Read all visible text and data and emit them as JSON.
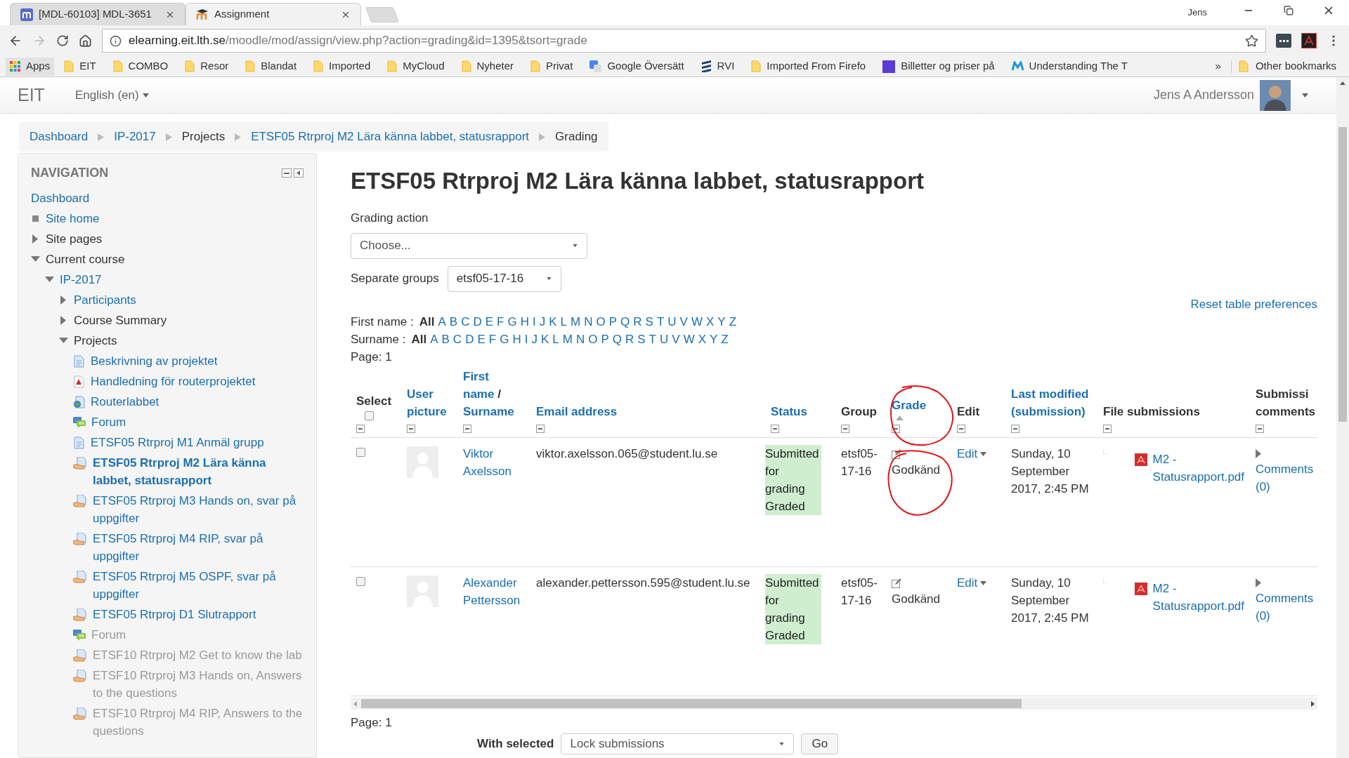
{
  "browser": {
    "tabs": [
      {
        "title": "[MDL-60103] MDL-3651",
        "selected": false
      },
      {
        "title": "Assignment",
        "selected": true
      }
    ],
    "profile": "Jens",
    "address": {
      "domain": "elearning.eit.lth.se",
      "path": "/moodle/mod/assign/view.php?action=grading&id=1395&tsort=grade"
    },
    "bookmarks": [
      {
        "label": "Apps",
        "kind": "apps"
      },
      {
        "label": "EIT",
        "kind": "folder"
      },
      {
        "label": "COMBO",
        "kind": "folder"
      },
      {
        "label": "Resor",
        "kind": "folder"
      },
      {
        "label": "Blandat",
        "kind": "folder"
      },
      {
        "label": "Imported",
        "kind": "folder"
      },
      {
        "label": "MyCloud",
        "kind": "folder"
      },
      {
        "label": "Nyheter",
        "kind": "folder"
      },
      {
        "label": "Privat",
        "kind": "folder"
      },
      {
        "label": "Google Översätt",
        "kind": "translate"
      },
      {
        "label": "RVI",
        "kind": "stack"
      },
      {
        "label": "Imported From Firefo",
        "kind": "folder"
      },
      {
        "label": "Billetter og priser på",
        "kind": "square"
      },
      {
        "label": "Understanding The T",
        "kind": "m"
      }
    ],
    "more": "»",
    "other": "Other bookmarks"
  },
  "site": {
    "brand": "EIT",
    "language": "English (en)",
    "user": "Jens A Andersson"
  },
  "breadcrumb": [
    {
      "label": "Dashboard",
      "link": true
    },
    {
      "label": "IP-2017",
      "link": true
    },
    {
      "label": "Projects",
      "link": false
    },
    {
      "label": "ETSF05 Rtrproj M2 Lära känna labbet, statusrapport",
      "link": true
    },
    {
      "label": "Grading",
      "link": false
    }
  ],
  "navigation": {
    "title": "NAVIGATION",
    "items": [
      {
        "label": "Dashboard",
        "kind": "plain",
        "link": true
      },
      {
        "label": "Site home",
        "kind": "bullet",
        "link": true
      },
      {
        "label": "Site pages",
        "kind": "branch",
        "link": false,
        "expanded": false
      },
      {
        "label": "Current course",
        "kind": "branch",
        "link": false,
        "expanded": true,
        "children": [
          {
            "label": "IP-2017",
            "kind": "branch",
            "link": true,
            "expanded": true,
            "children": [
              {
                "label": "Participants",
                "kind": "branch",
                "link": true,
                "expanded": false
              },
              {
                "label": "Course Summary",
                "kind": "branch",
                "link": false,
                "expanded": false
              },
              {
                "label": "Projects",
                "kind": "branch",
                "link": false,
                "expanded": true,
                "children": [
                  {
                    "label": "Beskrivning av projektet",
                    "kind": "page",
                    "selected": false,
                    "dimmed": false
                  },
                  {
                    "label": "Handledning för routerprojektet",
                    "kind": "pdf",
                    "selected": false,
                    "dimmed": false
                  },
                  {
                    "label": "Routerlabbet",
                    "kind": "url",
                    "selected": false,
                    "dimmed": false
                  },
                  {
                    "label": "Forum",
                    "kind": "forum",
                    "selected": false,
                    "dimmed": false
                  },
                  {
                    "label": "ETSF05 Rtrproj M1 Anmäl grupp",
                    "kind": "page",
                    "selected": false,
                    "dimmed": false
                  },
                  {
                    "label": "ETSF05 Rtrproj M2 Lära känna labbet, statusrapport",
                    "kind": "assign",
                    "selected": true,
                    "dimmed": false
                  },
                  {
                    "label": "ETSF05 Rtrproj M3 Hands on, svar på uppgifter",
                    "kind": "assign",
                    "selected": false,
                    "dimmed": false
                  },
                  {
                    "label": "ETSF05 Rtrproj M4 RIP, svar på uppgifter",
                    "kind": "assign",
                    "selected": false,
                    "dimmed": false
                  },
                  {
                    "label": "ETSF05 Rtrproj M5 OSPF, svar på uppgifter",
                    "kind": "assign",
                    "selected": false,
                    "dimmed": false
                  },
                  {
                    "label": "ETSF05 Rtrproj D1 Slutrapport",
                    "kind": "assign",
                    "selected": false,
                    "dimmed": false
                  },
                  {
                    "label": "Forum",
                    "kind": "forum",
                    "selected": false,
                    "dimmed": true
                  },
                  {
                    "label": "ETSF10 Rtrproj M2 Get to know the lab",
                    "kind": "assign",
                    "selected": false,
                    "dimmed": true
                  },
                  {
                    "label": "ETSF10 Rtrproj M3 Hands on, Answers to the questions",
                    "kind": "assign",
                    "selected": false,
                    "dimmed": true
                  },
                  {
                    "label": "ETSF10 Rtrproj M4 RIP, Answers to the questions",
                    "kind": "assign",
                    "selected": false,
                    "dimmed": true
                  }
                ]
              }
            ]
          }
        ]
      }
    ]
  },
  "main": {
    "title": "ETSF05 Rtrproj M2 Lära känna labbet, statusrapport",
    "grading_action": {
      "label": "Grading action",
      "value": "Choose..."
    },
    "groups": {
      "label": "Separate groups",
      "value": "etsf05-17-16"
    },
    "reset": "Reset table preferences",
    "filters": [
      {
        "label": "First name :",
        "letters": [
          {
            "label": "All",
            "selected": true
          },
          {
            "label": "A",
            "selected": false
          },
          {
            "label": "B",
            "selected": false
          },
          {
            "label": "C",
            "selected": false
          },
          {
            "label": "D",
            "selected": false
          },
          {
            "label": "E",
            "selected": false
          },
          {
            "label": "F",
            "selected": false
          },
          {
            "label": "G",
            "selected": false
          },
          {
            "label": "H",
            "selected": false
          },
          {
            "label": "I",
            "selected": false
          },
          {
            "label": "J",
            "selected": false
          },
          {
            "label": "K",
            "selected": false
          },
          {
            "label": "L",
            "selected": false
          },
          {
            "label": "M",
            "selected": false
          },
          {
            "label": "N",
            "selected": false
          },
          {
            "label": "O",
            "selected": false
          },
          {
            "label": "P",
            "selected": false
          },
          {
            "label": "Q",
            "selected": false
          },
          {
            "label": "R",
            "selected": false
          },
          {
            "label": "S",
            "selected": false
          },
          {
            "label": "T",
            "selected": false
          },
          {
            "label": "U",
            "selected": false
          },
          {
            "label": "V",
            "selected": false
          },
          {
            "label": "W",
            "selected": false
          },
          {
            "label": "X",
            "selected": false
          },
          {
            "label": "Y",
            "selected": false
          },
          {
            "label": "Z",
            "selected": false
          }
        ]
      },
      {
        "label": "Surname :",
        "letters": [
          {
            "label": "All",
            "selected": true
          },
          {
            "label": "A",
            "selected": false
          },
          {
            "label": "B",
            "selected": false
          },
          {
            "label": "C",
            "selected": false
          },
          {
            "label": "D",
            "selected": false
          },
          {
            "label": "E",
            "selected": false
          },
          {
            "label": "F",
            "selected": false
          },
          {
            "label": "G",
            "selected": false
          },
          {
            "label": "H",
            "selected": false
          },
          {
            "label": "I",
            "selected": false
          },
          {
            "label": "J",
            "selected": false
          },
          {
            "label": "K",
            "selected": false
          },
          {
            "label": "L",
            "selected": false
          },
          {
            "label": "M",
            "selected": false
          },
          {
            "label": "N",
            "selected": false
          },
          {
            "label": "O",
            "selected": false
          },
          {
            "label": "P",
            "selected": false
          },
          {
            "label": "Q",
            "selected": false
          },
          {
            "label": "R",
            "selected": false
          },
          {
            "label": "S",
            "selected": false
          },
          {
            "label": "T",
            "selected": false
          },
          {
            "label": "U",
            "selected": false
          },
          {
            "label": "V",
            "selected": false
          },
          {
            "label": "W",
            "selected": false
          },
          {
            "label": "X",
            "selected": false
          },
          {
            "label": "Y",
            "selected": false
          },
          {
            "label": "Z",
            "selected": false
          }
        ]
      }
    ],
    "page_top": "Page: 1",
    "table": {
      "select_all": {
        "checked": false
      },
      "columns": [
        {
          "label": "Select",
          "link": false,
          "sorted": false
        },
        {
          "label": "User picture",
          "link": true,
          "sorted": false
        },
        {
          "label": "First name",
          "separator": "/",
          "extra": "Surname",
          "link": true,
          "sorted": false
        },
        {
          "label": "Email address",
          "link": true,
          "sorted": false
        },
        {
          "label": "Status",
          "link": true,
          "sorted": false
        },
        {
          "label": "Group",
          "link": false,
          "sorted": false
        },
        {
          "label": "Grade",
          "link": true,
          "sorted": true
        },
        {
          "label": "Edit",
          "link": false,
          "sorted": false
        },
        {
          "label": "Last modified (submission)",
          "link": true,
          "sorted": false
        },
        {
          "label": "File submissions",
          "link": false,
          "sorted": false
        },
        {
          "label": "Submissi comments",
          "link": false,
          "sorted": false
        }
      ],
      "rows": [
        {
          "checked": false,
          "name": "Viktor Axelsson",
          "email": "viktor.axelsson.065@student.lu.se",
          "status": [
            "Submitted for grading",
            "Graded"
          ],
          "group": "etsf05-17-16",
          "grade": "Godkänd",
          "edit": "Edit",
          "modified": "Sunday, 10 September 2017, 2:45 PM",
          "file": "M2 - Statusrapport.pdf",
          "comments": "Comments (0)"
        },
        {
          "checked": false,
          "name": "Alexander Pettersson",
          "email": "alexander.pettersson.595@student.lu.se",
          "status": [
            "Submitted for grading",
            "Graded"
          ],
          "group": "etsf05-17-16",
          "grade": "Godkänd",
          "edit": "Edit",
          "modified": "Sunday, 10 September 2017, 2:45 PM",
          "file": "M2 - Statusrapport.pdf",
          "comments": "Comments (0)"
        }
      ]
    },
    "page_bottom": "Page: 1",
    "with_selected": {
      "label": "With selected",
      "value": "Lock submissions",
      "button": "Go"
    }
  }
}
